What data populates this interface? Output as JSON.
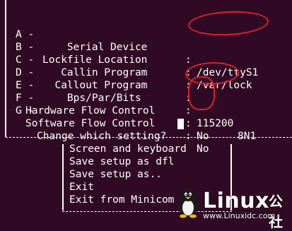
{
  "settings": [
    {
      "key": "A -",
      "name": "    Serial Device",
      "value": "/dev/ttyS1",
      "value2": ""
    },
    {
      "key": "B -",
      "name": "Lockfile Location",
      "value": "/var/lock",
      "value2": ""
    },
    {
      "key": "C -",
      "name": "   Callin Program",
      "value": "",
      "value2": ""
    },
    {
      "key": "D -",
      "name": "  Callout Program",
      "value": "",
      "value2": ""
    },
    {
      "key": "E -",
      "name": "    Bps/Par/Bits",
      "value": "115200",
      "value2": "8N1"
    },
    {
      "key": "F -",
      "name": "Hardware Flow Control",
      "value": "No",
      "value2": ""
    },
    {
      "key": "G -",
      "name": "Software Flow Control",
      "value": "No",
      "value2": ""
    }
  ],
  "colon": ":",
  "prompt": "Change which setting?",
  "menu": {
    "items": [
      "Screen and keyboard",
      "Save setup as dfl",
      "Save setup as..",
      "Exit",
      "Exit from Minicom"
    ]
  },
  "logo": {
    "text": "Linux",
    "cn": "公社",
    "url": "www.Linuxidc.com"
  },
  "colors": {
    "background": "#300a24",
    "foreground": "#ffffff",
    "annotation": "#e0202a"
  }
}
